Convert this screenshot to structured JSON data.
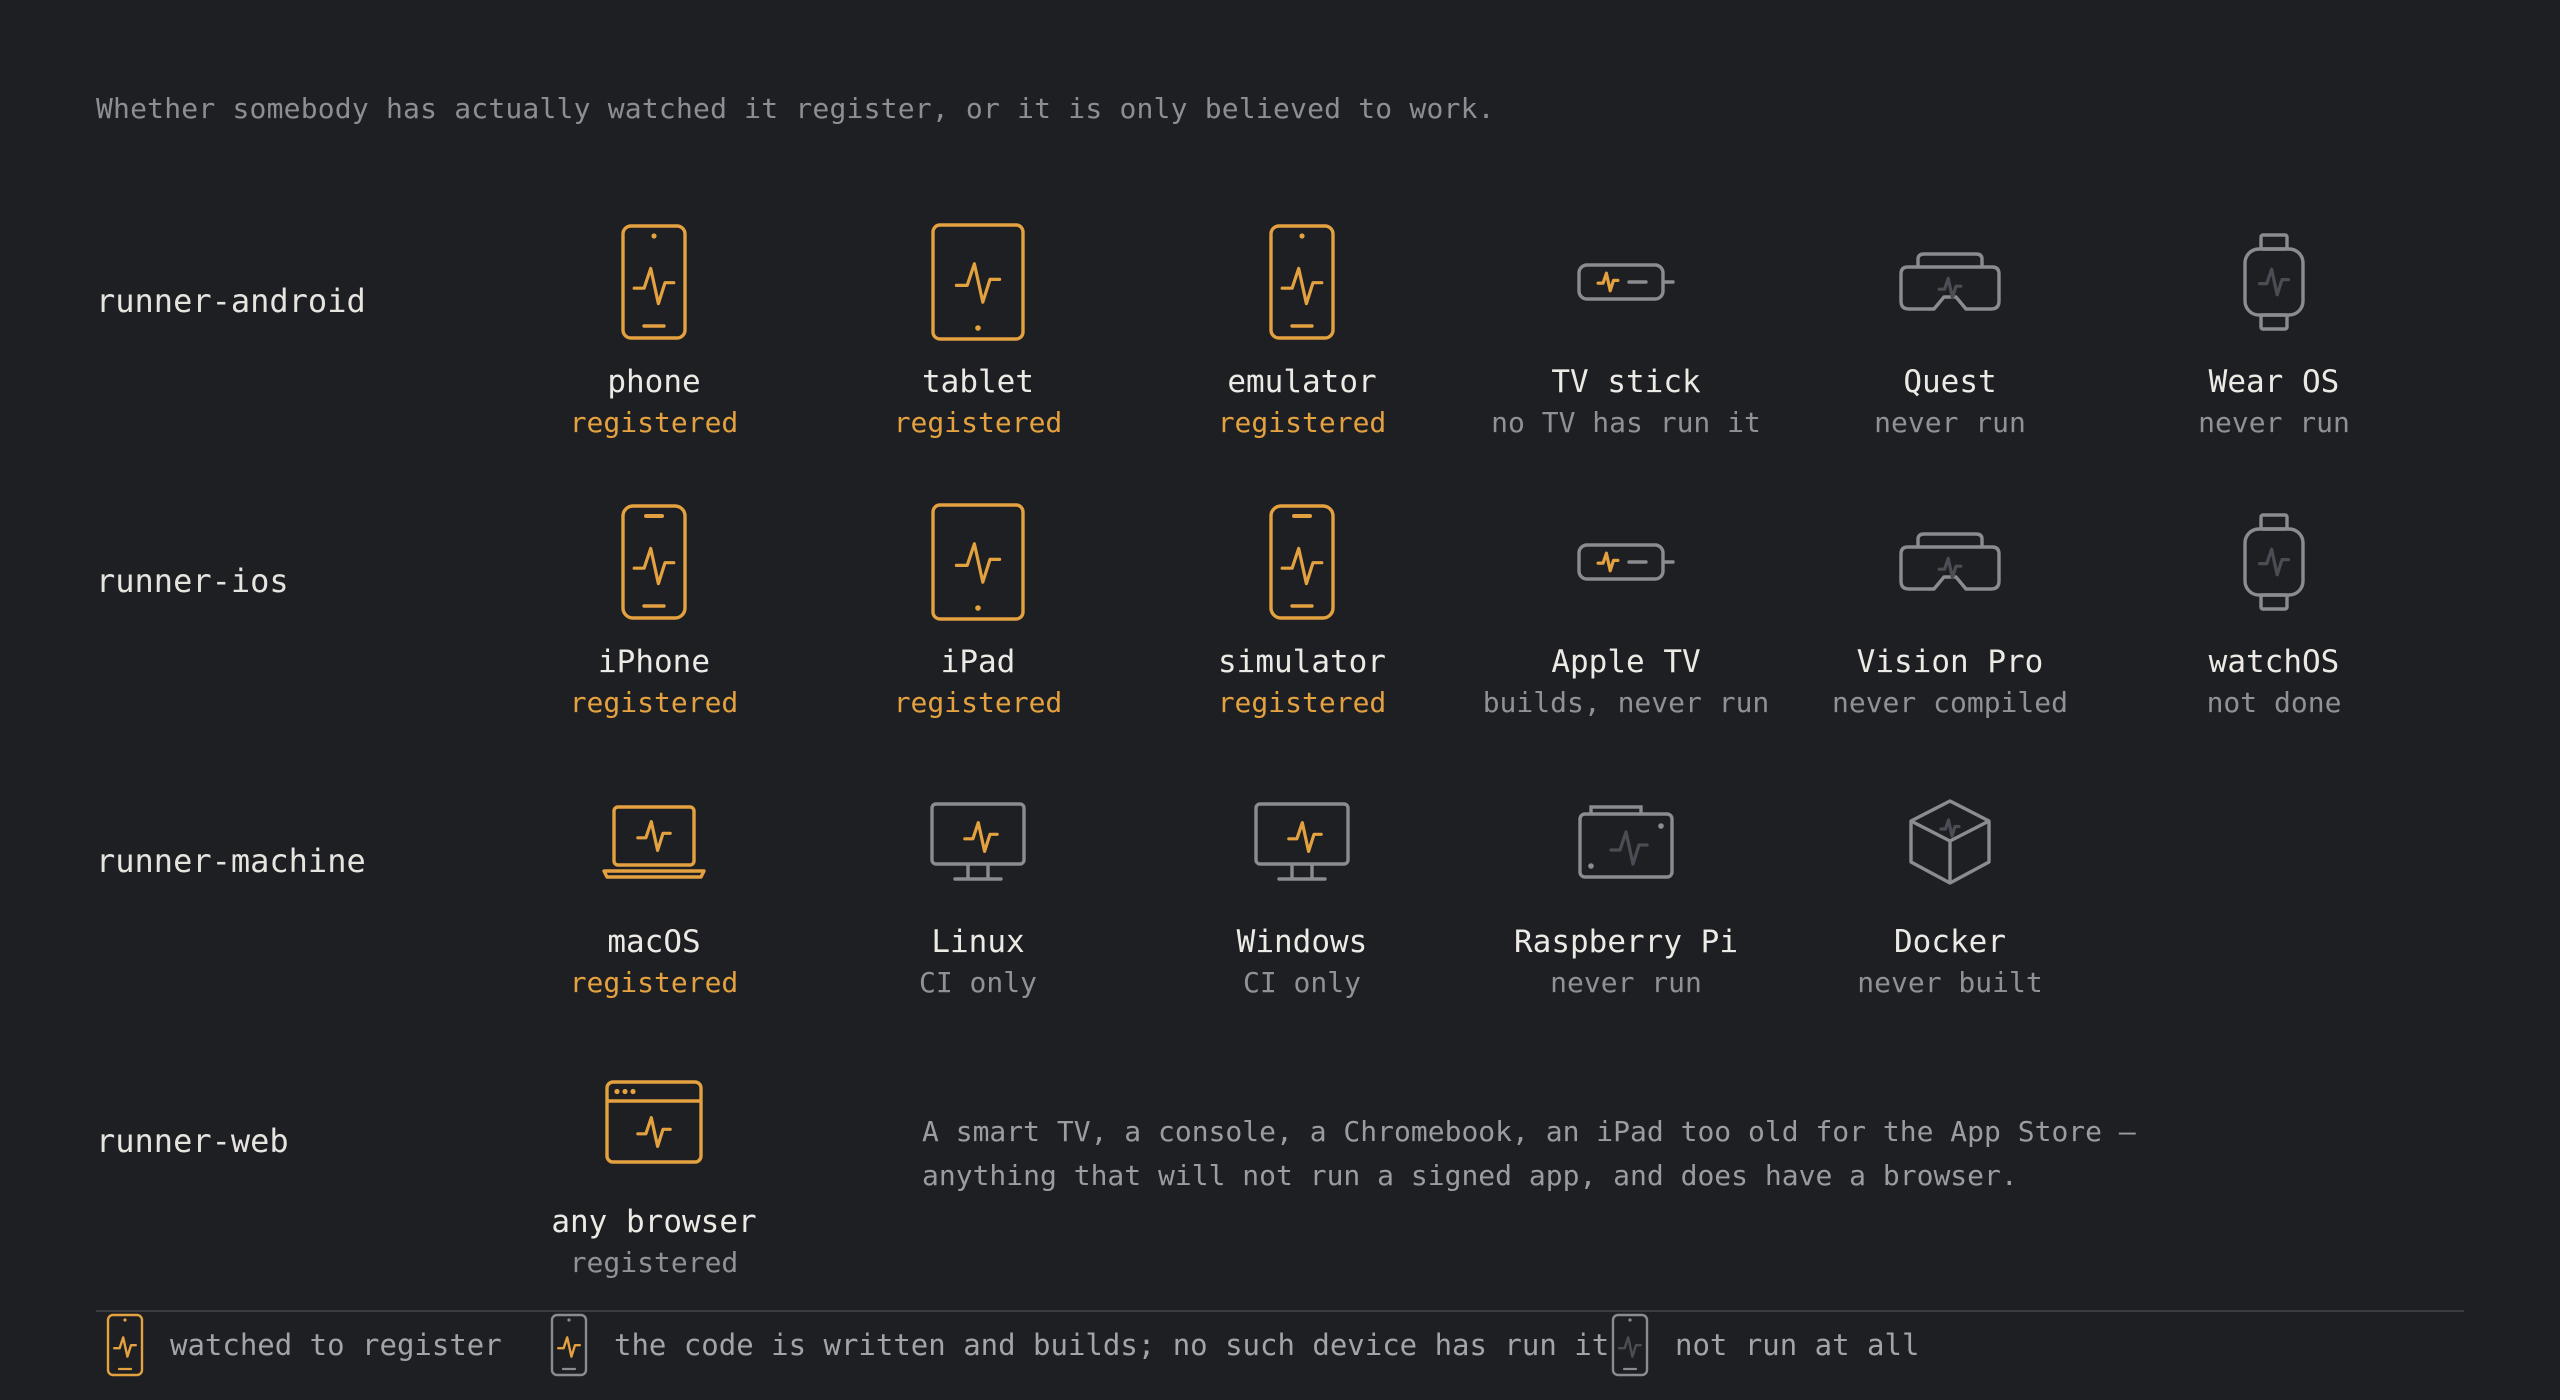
{
  "subtitle": "Whether somebody has actually watched it register, or it is only believed to work.",
  "colors": {
    "accent": "#e3a13f",
    "muted": "#8f9195",
    "background": "#1d1f23",
    "text": "#eceae5"
  },
  "rows": [
    {
      "label": "runner-android",
      "devices": [
        {
          "name": "phone",
          "status": "registered",
          "state": "registered",
          "icon": "phone-icon"
        },
        {
          "name": "tablet",
          "status": "registered",
          "state": "registered",
          "icon": "tablet-icon"
        },
        {
          "name": "emulator",
          "status": "registered",
          "state": "registered",
          "icon": "phone-icon"
        },
        {
          "name": "TV stick",
          "status": "no TV has run it",
          "state": "partial",
          "icon": "tv-stick-icon"
        },
        {
          "name": "Quest",
          "status": "never run",
          "state": "none",
          "icon": "vr-headset-icon"
        },
        {
          "name": "Wear OS",
          "status": "never run",
          "state": "none",
          "icon": "watch-icon"
        }
      ]
    },
    {
      "label": "runner-ios",
      "devices": [
        {
          "name": "iPhone",
          "status": "registered",
          "state": "registered",
          "icon": "iphone-icon"
        },
        {
          "name": "iPad",
          "status": "registered",
          "state": "registered",
          "icon": "tablet-icon"
        },
        {
          "name": "simulator",
          "status": "registered",
          "state": "registered",
          "icon": "iphone-icon"
        },
        {
          "name": "Apple TV",
          "status": "builds, never run",
          "state": "partial",
          "icon": "tv-stick-icon"
        },
        {
          "name": "Vision Pro",
          "status": "never compiled",
          "state": "none",
          "icon": "vr-headset-icon"
        },
        {
          "name": "watchOS",
          "status": "not done",
          "state": "none",
          "icon": "watch-icon"
        }
      ]
    },
    {
      "label": "runner-machine",
      "devices": [
        {
          "name": "macOS",
          "status": "registered",
          "state": "registered",
          "icon": "laptop-icon"
        },
        {
          "name": "Linux",
          "status": "CI only",
          "state": "partial",
          "icon": "monitor-icon"
        },
        {
          "name": "Windows",
          "status": "CI only",
          "state": "partial",
          "icon": "monitor-icon"
        },
        {
          "name": "Raspberry Pi",
          "status": "never run",
          "state": "none",
          "icon": "board-icon"
        },
        {
          "name": "Docker",
          "status": "never built",
          "state": "none",
          "icon": "container-icon"
        }
      ]
    },
    {
      "label": "runner-web",
      "devices": [
        {
          "name": "any browser",
          "status": "registered",
          "state": "registered-web",
          "icon": "browser-icon"
        }
      ]
    }
  ],
  "web_note": "A smart TV, a console, a Chromebook, an iPad too old for the App Store — anything that will not run a signed app, and does have a browser.",
  "legend": [
    {
      "text": "watched to register",
      "state": "registered"
    },
    {
      "text": "the code is written and builds; no such device has run it",
      "state": "partial"
    },
    {
      "text": "not run at all",
      "state": "none"
    }
  ]
}
